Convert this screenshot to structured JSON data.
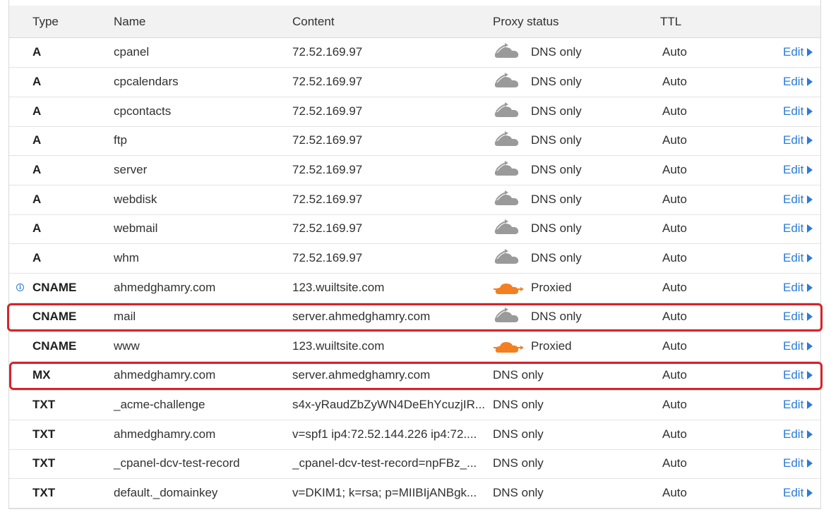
{
  "columns": {
    "type": "Type",
    "name": "Name",
    "content": "Content",
    "proxy": "Proxy status",
    "ttl": "TTL"
  },
  "records": [
    {
      "type": "A",
      "name": "cpanel",
      "content": "72.52.169.97",
      "proxy": "DNS only",
      "proxy_icon": "cloud-gray-icon",
      "ttl": "Auto",
      "edit": "Edit"
    },
    {
      "type": "A",
      "name": "cpcalendars",
      "content": "72.52.169.97",
      "proxy": "DNS only",
      "proxy_icon": "cloud-gray-icon",
      "ttl": "Auto",
      "edit": "Edit"
    },
    {
      "type": "A",
      "name": "cpcontacts",
      "content": "72.52.169.97",
      "proxy": "DNS only",
      "proxy_icon": "cloud-gray-icon",
      "ttl": "Auto",
      "edit": "Edit"
    },
    {
      "type": "A",
      "name": "ftp",
      "content": "72.52.169.97",
      "proxy": "DNS only",
      "proxy_icon": "cloud-gray-icon",
      "ttl": "Auto",
      "edit": "Edit"
    },
    {
      "type": "A",
      "name": "server",
      "content": "72.52.169.97",
      "proxy": "DNS only",
      "proxy_icon": "cloud-gray-icon",
      "ttl": "Auto",
      "edit": "Edit"
    },
    {
      "type": "A",
      "name": "webdisk",
      "content": "72.52.169.97",
      "proxy": "DNS only",
      "proxy_icon": "cloud-gray-icon",
      "ttl": "Auto",
      "edit": "Edit"
    },
    {
      "type": "A",
      "name": "webmail",
      "content": "72.52.169.97",
      "proxy": "DNS only",
      "proxy_icon": "cloud-gray-icon",
      "ttl": "Auto",
      "edit": "Edit"
    },
    {
      "type": "A",
      "name": "whm",
      "content": "72.52.169.97",
      "proxy": "DNS only",
      "proxy_icon": "cloud-gray-icon",
      "ttl": "Auto",
      "edit": "Edit"
    },
    {
      "type": "CNAME",
      "name": "ahmedghamry.com",
      "content": "123.wuiltsite.com",
      "proxy": "Proxied",
      "proxy_icon": "cloud-orange-icon",
      "ttl": "Auto",
      "edit": "Edit",
      "info_icon": "info-icon"
    },
    {
      "type": "CNAME",
      "name": "mail",
      "content": "server.ahmedghamry.com",
      "proxy": "DNS only",
      "proxy_icon": "cloud-gray-icon",
      "ttl": "Auto",
      "edit": "Edit"
    },
    {
      "type": "CNAME",
      "name": "www",
      "content": "123.wuiltsite.com",
      "proxy": "Proxied",
      "proxy_icon": "cloud-orange-icon",
      "ttl": "Auto",
      "edit": "Edit"
    },
    {
      "type": "MX",
      "name": "ahmedghamry.com",
      "content": "server.ahmedghamry.com",
      "proxy": "DNS only",
      "proxy_icon": "",
      "ttl": "Auto",
      "edit": "Edit"
    },
    {
      "type": "TXT",
      "name": "_acme-challenge",
      "content": "s4x-yRaudZbZyWN4DeEhYcuzjIR...",
      "proxy": "DNS only",
      "proxy_icon": "",
      "ttl": "Auto",
      "edit": "Edit"
    },
    {
      "type": "TXT",
      "name": "ahmedghamry.com",
      "content": "v=spf1 ip4:72.52.144.226 ip4:72....",
      "proxy": "DNS only",
      "proxy_icon": "",
      "ttl": "Auto",
      "edit": "Edit"
    },
    {
      "type": "TXT",
      "name": "_cpanel-dcv-test-record",
      "content": "_cpanel-dcv-test-record=npFBz_...",
      "proxy": "DNS only",
      "proxy_icon": "",
      "ttl": "Auto",
      "edit": "Edit"
    },
    {
      "type": "TXT",
      "name": "default._domainkey",
      "content": "v=DKIM1; k=rsa; p=MIIBIjANBgk...",
      "proxy": "DNS only",
      "proxy_icon": "",
      "ttl": "Auto",
      "edit": "Edit"
    }
  ],
  "colors": {
    "cloud_gray": "#9a9a9a",
    "cloud_orange": "#f38020",
    "link": "#2c7cd5",
    "highlight": "#d6232b"
  },
  "highlighted_records": [
    "mail",
    "MX ahmedghamry.com"
  ]
}
